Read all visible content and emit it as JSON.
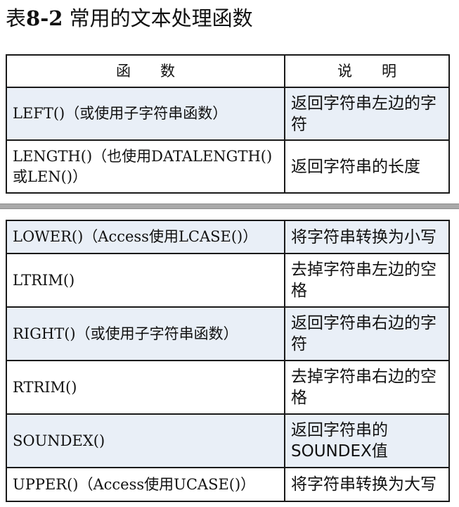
{
  "document": {
    "title_prefix": "表",
    "title_number": "8-2",
    "title_text": " 常用的文本处理函数"
  },
  "table": {
    "headers": {
      "function": "函　　数",
      "description": "说　　明"
    },
    "top_rows": [
      {
        "function": "LEFT()（或使用子字符串函数）",
        "description": "返回字符串左边的字符"
      },
      {
        "function": "LENGTH()（也使用DATALENGTH()或LEN()）",
        "description": "返回字符串的长度"
      }
    ],
    "bottom_rows": [
      {
        "function": "LOWER()（Access使用LCASE()）",
        "description": "将字符串转换为小写"
      },
      {
        "function": "LTRIM()",
        "description": "去掉字符串左边的空格"
      },
      {
        "function": "RIGHT()（或使用子字符串函数）",
        "description": "返回字符串右边的字符"
      },
      {
        "function": "RTRIM()",
        "description": "去掉字符串右边的空格"
      },
      {
        "function": "SOUNDEX()",
        "description": "返回字符串的SOUNDEX值"
      },
      {
        "function": "UPPER()（Access使用UCASE()）",
        "description": "将字符串转换为大写"
      }
    ]
  },
  "colors": {
    "shaded_row": "#e9eff7",
    "divider": "#a9a9a9",
    "border": "#1a1a1a"
  }
}
